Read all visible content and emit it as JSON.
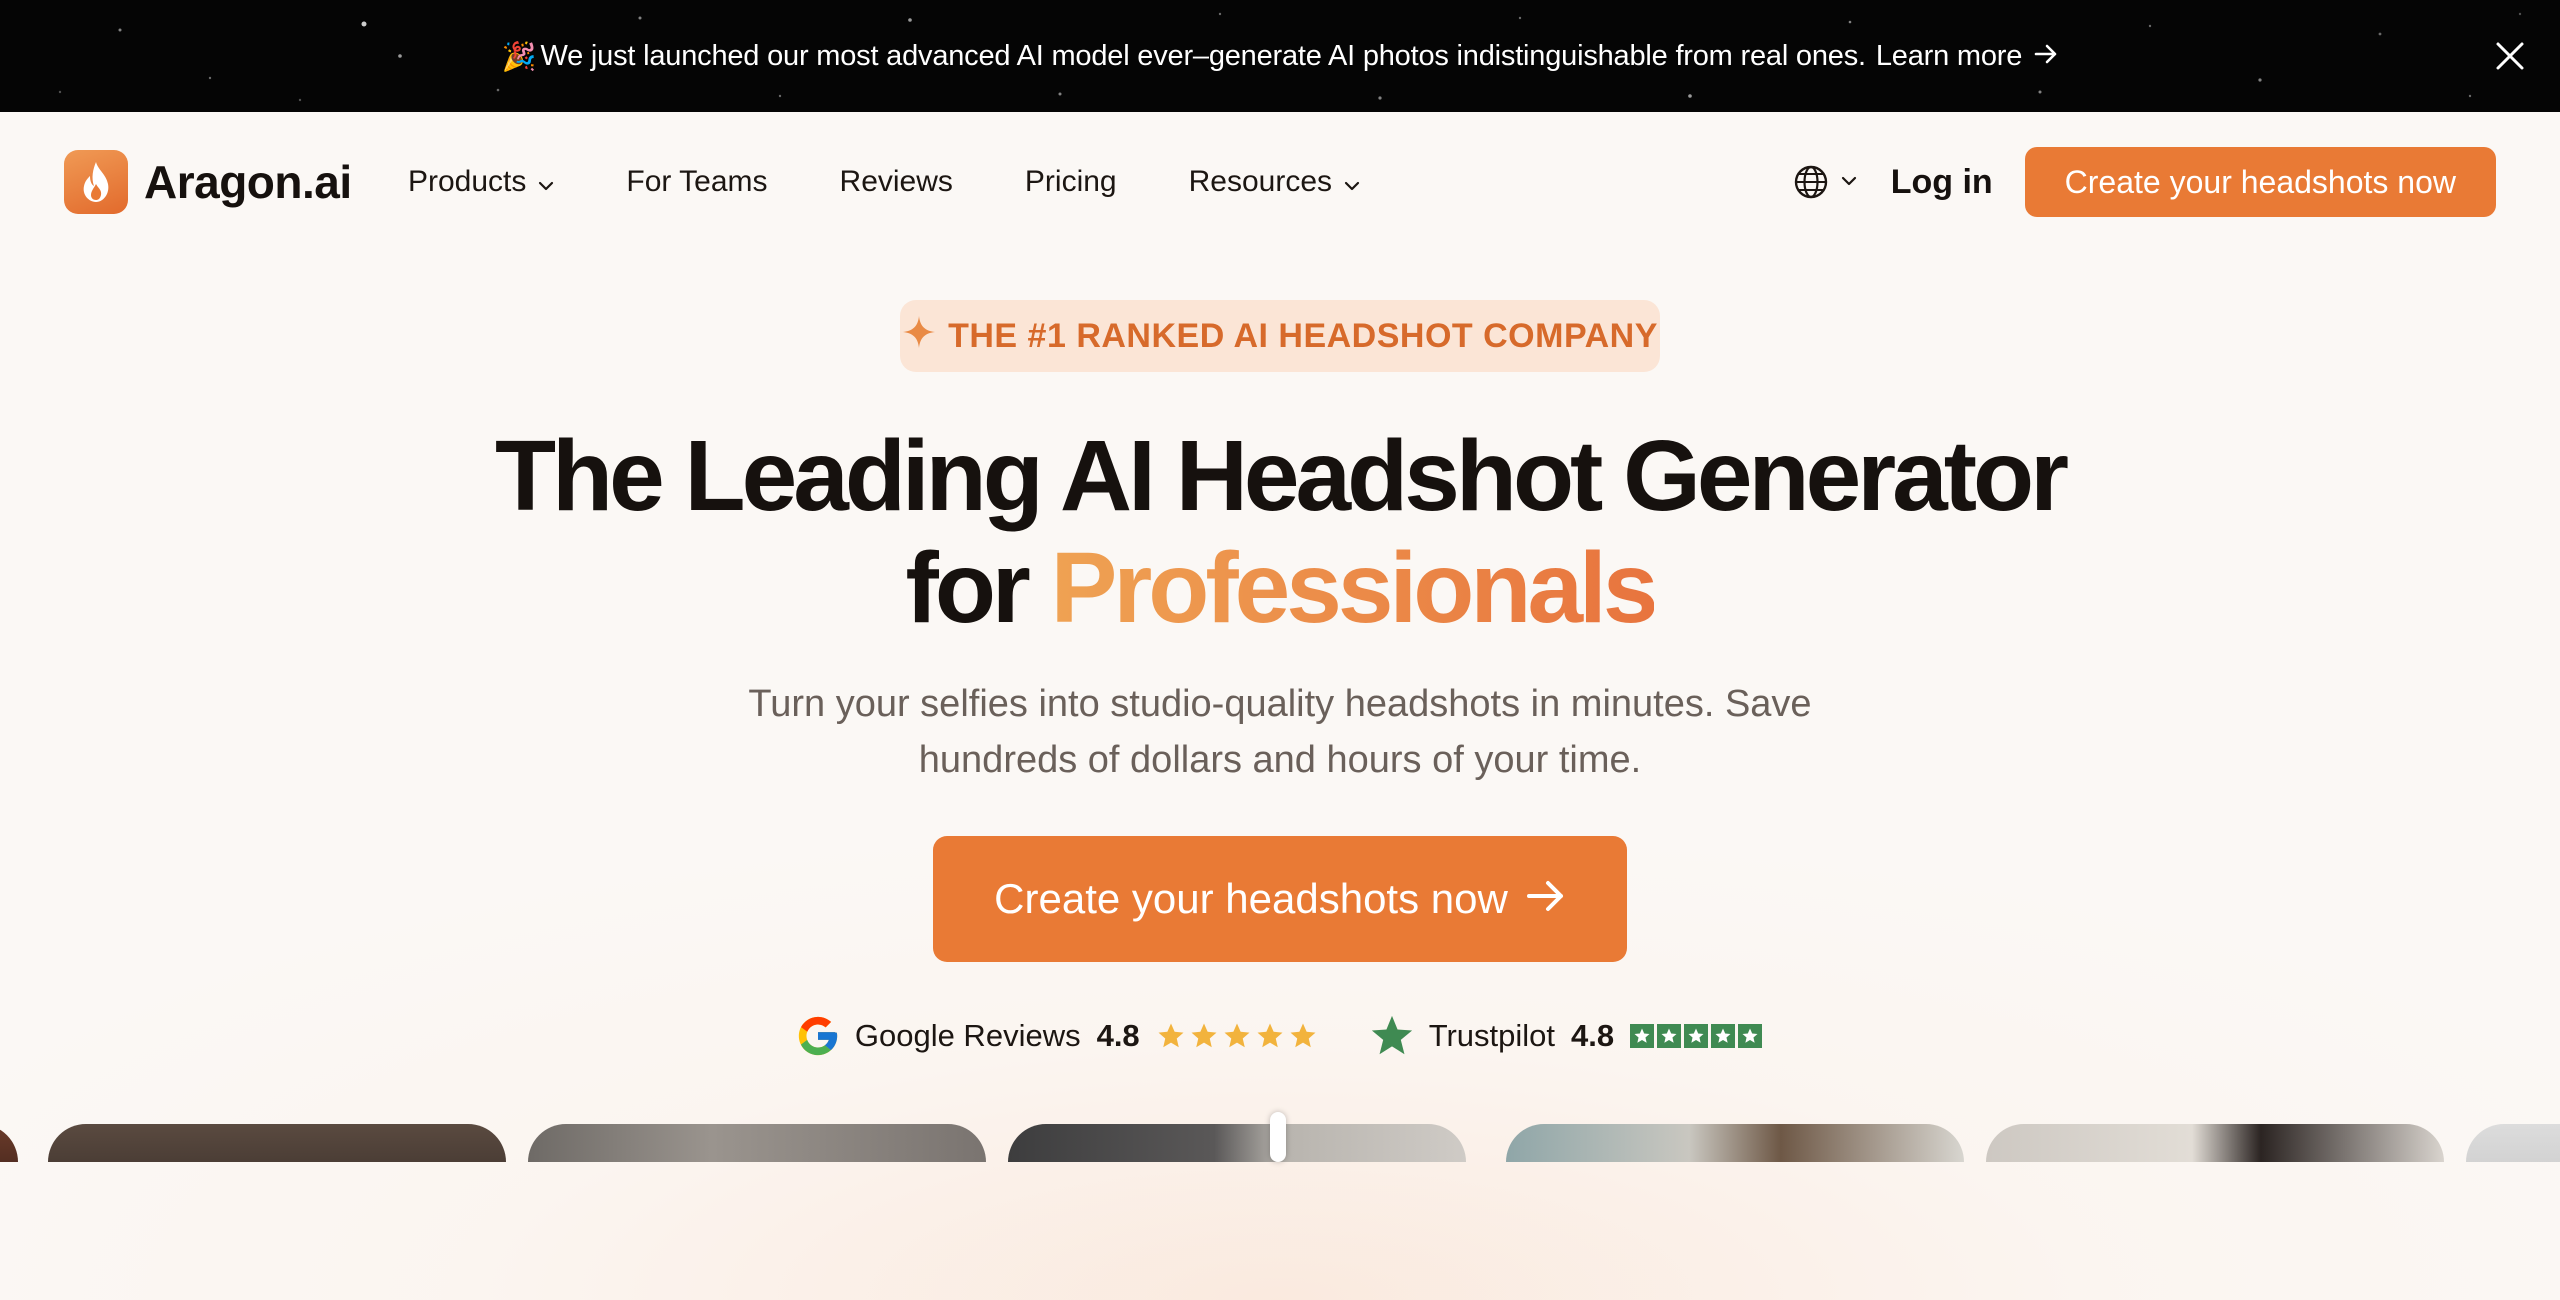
{
  "announcement": {
    "emoji": "🎉",
    "text": "We just launched our most advanced AI model ever–generate AI photos indistinguishable from real ones.",
    "link_label": "Learn more",
    "arrow_icon": "arrow-right-icon",
    "close_icon": "close-icon"
  },
  "nav": {
    "logo_text": "Aragon.ai",
    "logo_icon": "flame-icon",
    "items": [
      {
        "label": "Products",
        "has_dropdown": true
      },
      {
        "label": "For Teams",
        "has_dropdown": false
      },
      {
        "label": "Reviews",
        "has_dropdown": false
      },
      {
        "label": "Pricing",
        "has_dropdown": false
      },
      {
        "label": "Resources",
        "has_dropdown": true
      }
    ],
    "language_icon": "globe-icon",
    "login_label": "Log in",
    "cta_label": "Create your headshots now"
  },
  "hero": {
    "badge": "THE #1 RANKED AI HEADSHOT COMPANY",
    "title_line1": "The Leading AI Headshot Generator",
    "title_for": "for",
    "title_accent": "Professionals",
    "subtitle": "Turn your selfies into studio-quality headshots in minutes. Save hundreds of dollars and hours of your time.",
    "cta_label": "Create your headshots now"
  },
  "ratings": [
    {
      "source": "Google Reviews",
      "score": "4.8",
      "icon": "google-icon",
      "stars": 5
    },
    {
      "source": "Trustpilot",
      "score": "4.8",
      "icon": "trustpilot-star-icon",
      "stars": 5
    }
  ],
  "colors": {
    "accent": "#e97a35",
    "badge_bg": "#fbe5d6",
    "badge_text": "#d76a2b",
    "announcement_bg": "#050505",
    "page_bg": "#fbf8f5",
    "trustpilot_green": "#3f8a52",
    "star_gold": "#f2b33d"
  }
}
